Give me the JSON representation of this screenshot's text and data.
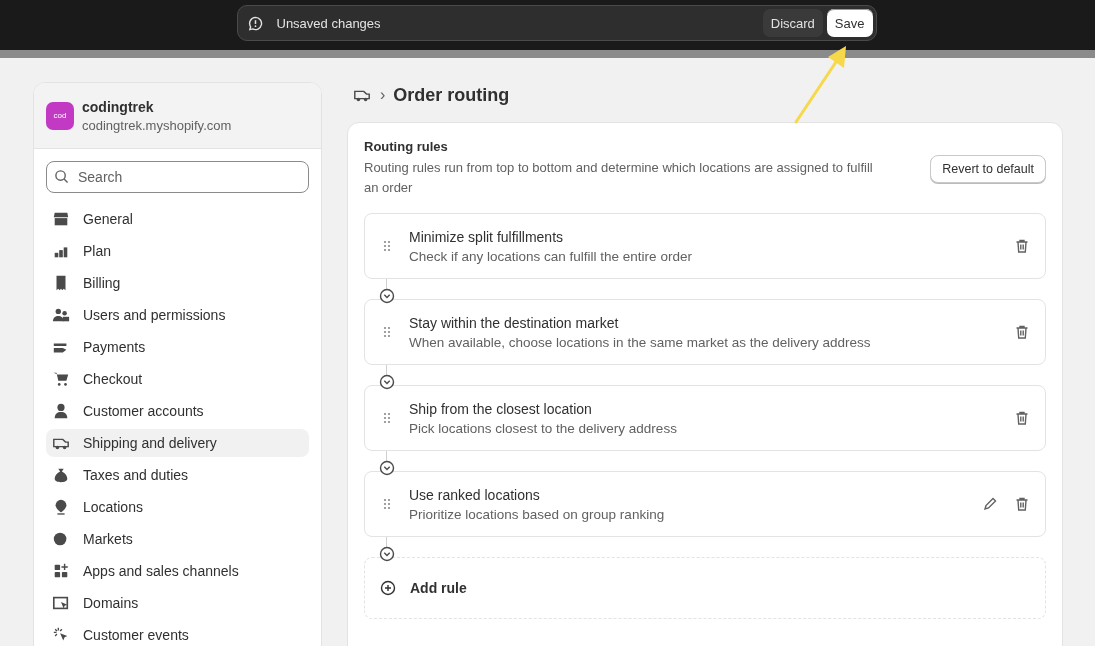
{
  "save_bar": {
    "message": "Unsaved changes",
    "buttons": [
      {
        "label": "Discard",
        "kind": "secondary"
      },
      {
        "label": "Save",
        "kind": "primary"
      }
    ]
  },
  "sidebar": {
    "store": {
      "badge": "cod",
      "name": "codingtrek",
      "domain": "codingtrek.myshopify.com"
    },
    "search": {
      "placeholder": "Search"
    },
    "items": [
      {
        "label": "General",
        "selected": false
      },
      {
        "label": "Plan",
        "selected": false
      },
      {
        "label": "Billing",
        "selected": false
      },
      {
        "label": "Users and permissions",
        "selected": false
      },
      {
        "label": "Payments",
        "selected": false
      },
      {
        "label": "Checkout",
        "selected": false
      },
      {
        "label": "Customer accounts",
        "selected": false
      },
      {
        "label": "Shipping and delivery",
        "selected": true
      },
      {
        "label": "Taxes and duties",
        "selected": false
      },
      {
        "label": "Locations",
        "selected": false
      },
      {
        "label": "Markets",
        "selected": false
      },
      {
        "label": "Apps and sales channels",
        "selected": false
      },
      {
        "label": "Domains",
        "selected": false
      },
      {
        "label": "Customer events",
        "selected": false
      }
    ]
  },
  "breadcrumb": {
    "separator": "›",
    "title": "Order routing"
  },
  "routing": {
    "title": "Routing rules",
    "description": "Routing rules run from top to bottom and determine which locations are assigned to fulfill an order",
    "revert_button": "Revert to default",
    "rules": [
      {
        "title": "Minimize split fulfillments",
        "description": "Check if any locations can fulfill the entire order",
        "editable": false
      },
      {
        "title": "Stay within the destination market",
        "description": "When available, choose locations in the same market as the delivery address",
        "editable": false
      },
      {
        "title": "Ship from the closest location",
        "description": "Pick locations closest to the delivery address",
        "editable": false
      },
      {
        "title": "Use ranked locations",
        "description": "Prioritize locations based on group ranking",
        "editable": true
      }
    ],
    "add_rule": "Add rule"
  }
}
